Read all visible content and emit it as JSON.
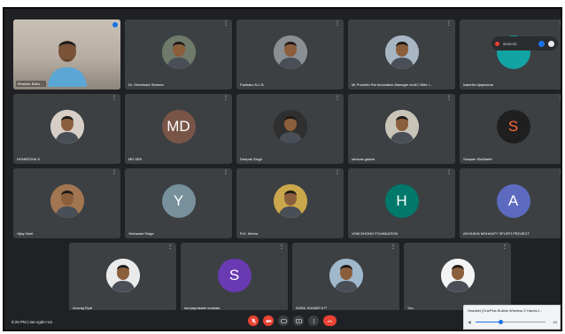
{
  "self_view": {
    "name": "Bhaskar Babu ..."
  },
  "recording": {
    "time": "00:51:02"
  },
  "participants": [
    {
      "name": "Dr. Shreekant Sharma",
      "kind": "photo",
      "bg": "#6f7a6b"
    },
    {
      "name": "Pankaku N.L.B",
      "kind": "photo",
      "bg": "#8a8f93"
    },
    {
      "name": "Mr Puneeth Rai Incubation Manager at AIC Nitte I...",
      "kind": "photo",
      "bg": "#a8b6c4"
    },
    {
      "name": "Isabella vijaykumar",
      "kind": "initial",
      "initial": "",
      "bg": "#12a4a4"
    },
    {
      "name": "HONEESHA S",
      "kind": "photo",
      "bg": "#d7cfc7"
    },
    {
      "name": "MD SIRI",
      "kind": "initial",
      "initial": "MD",
      "bg": "#795548"
    },
    {
      "name": "Deepak Singh",
      "kind": "photo",
      "bg": "#2f2f2f"
    },
    {
      "name": "srinivas gadda",
      "kind": "photo",
      "bg": "#c9c4b8"
    },
    {
      "name": "Swapan Siddharth",
      "kind": "initial",
      "initial": "S",
      "bg": "#1f1f1f",
      "fg": "#ff6a3d"
    },
    {
      "name": "Vijay Noel",
      "kind": "photo",
      "bg": "#a17651"
    },
    {
      "name": "Yeshwant Sirige",
      "kind": "initial",
      "initial": "Y",
      "bg": "#78909c"
    },
    {
      "name": "R.K. Mehra",
      "kind": "photo",
      "bg": "#c9a74a"
    },
    {
      "name": "VOM DHONO FOUNDATION",
      "kind": "initial",
      "initial": "H",
      "bg": "#00796b"
    },
    {
      "name": "ADYASHA MOHANTY SFURTI PROJECT",
      "kind": "initial",
      "initial": "A",
      "bg": "#5c6bc0"
    },
    {
      "name": "Anurag Ryal",
      "kind": "photo",
      "bg": "#eaeaea"
    },
    {
      "name": "surryaprakash konkala",
      "kind": "initial",
      "initial": "S",
      "bg": "#6a3ab2"
    },
    {
      "name": "SUNIL KUMAR N P",
      "kind": "photo",
      "bg": "#9fb8cc"
    },
    {
      "name": "You",
      "kind": "photo",
      "bg": "#f4f4f4"
    }
  ],
  "bottom_bar": {
    "time": "8:26 PM",
    "meeting_code": "ian-vgde-ncs"
  },
  "audio_popup": {
    "device": "Headset (OnePlus Bullets Wireless Z Hands-f...",
    "volume_label": "24",
    "volume_level": 0.35
  }
}
